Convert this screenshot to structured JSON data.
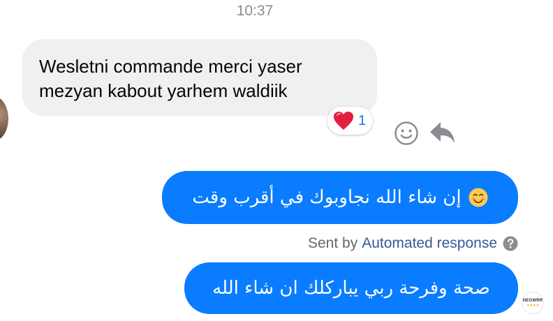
{
  "conversation": {
    "timestamp": "10:37",
    "incoming": {
      "text_line1": "Wesletni commande merci yaser",
      "text_line2": "mezyan kabout yarhem waldiik",
      "reaction": {
        "emoji_icon": "heart-icon",
        "count": "1"
      }
    },
    "outgoing": [
      {
        "text": "إن شاء الله نجاوبوك في أقرب وقت",
        "emoji_icon": "smiling-face-icon"
      },
      {
        "text": "صحة وفرحة ربي يباركلك ان شاء الله"
      }
    ],
    "sent_by": {
      "prefix": "Sent by",
      "name": "Automated response"
    },
    "seen_avatar": {
      "brand": "NEGWRR",
      "stars": "★★★★"
    }
  },
  "colors": {
    "outgoing_bubble": "#0a7cff",
    "incoming_bubble": "#f0f0f0",
    "reaction_count": "#1b74e4",
    "link": "#385898",
    "muted_text": "#65676b"
  }
}
